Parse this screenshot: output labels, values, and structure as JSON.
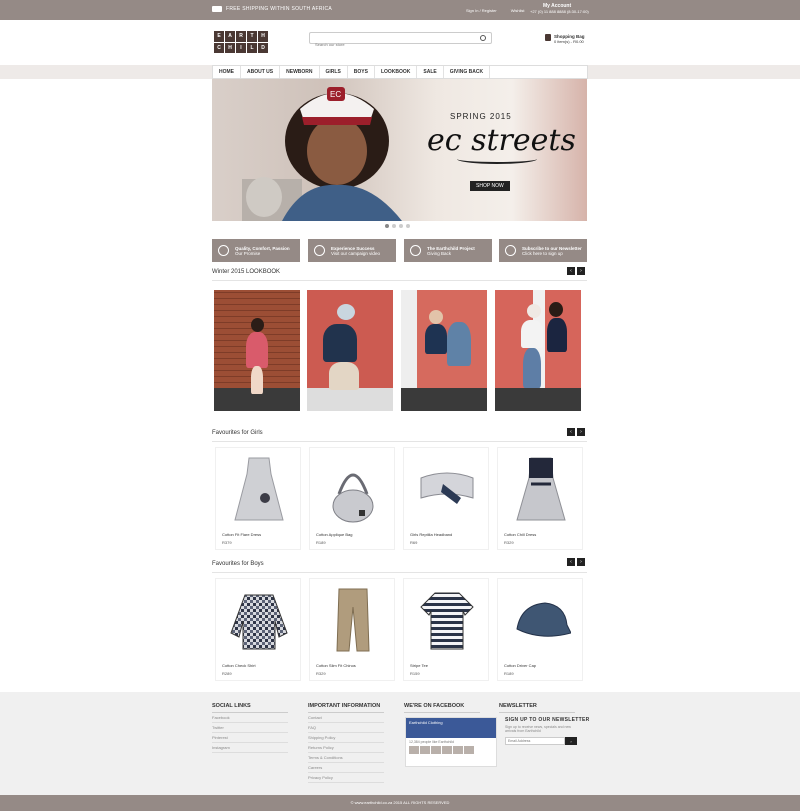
{
  "topbar": {
    "shipping_text": "FREE SHIPPING WITHIN SOUTH AFRICA",
    "link_account": "Sign In / Register",
    "link_wishlist": "Wishlist",
    "account_label": "My Account",
    "phone": "+27 (0) 11 888 8888 (8:30-17:00)"
  },
  "logo": {
    "letters": [
      "E",
      "A",
      "R",
      "T",
      "H",
      "C",
      "H",
      "I",
      "L",
      "D"
    ]
  },
  "search": {
    "placeholder": "Search our store"
  },
  "cart": {
    "title": "Shopping Bag",
    "summary": "0 item(s) - R0.00"
  },
  "nav": {
    "items": [
      "HOME",
      "ABOUT US",
      "NEWBORN",
      "GIRLS",
      "BOYS",
      "LOOKBOOK",
      "SALE",
      "GIVING BACK"
    ]
  },
  "hero": {
    "season": "SPRING 2015",
    "title": "ec streets",
    "cta": "SHOP NOW",
    "cap_text": "EC",
    "slides": 4,
    "active_slide": 1
  },
  "features": [
    {
      "title": "Quality, Comfort, Passion",
      "sub": "Our Promise"
    },
    {
      "title": "Experience Success",
      "sub": "Visit our campaign video"
    },
    {
      "title": "The Earthchild Project",
      "sub": "Giving Back"
    },
    {
      "title": "Subscribe to our Newsletter",
      "sub": "Click here to sign up"
    }
  ],
  "lookbook": {
    "title": "Winter 2015 LOOKBOOK"
  },
  "girls": {
    "title": "Favourites for Girls",
    "products": [
      {
        "name": "Cotton Fit Flare Dress",
        "price": "R379"
      },
      {
        "name": "Cotton Applique Bag",
        "price": "R189"
      },
      {
        "name": "Girls Reptilia Headband",
        "price": "R69"
      },
      {
        "name": "Cotton Chill Dress",
        "price": "R329"
      }
    ]
  },
  "boys": {
    "title": "Favourites for Boys",
    "products": [
      {
        "name": "Cotton Check Shirt",
        "price": "R289"
      },
      {
        "name": "Cotton Slim Fit Chinos",
        "price": "R329"
      },
      {
        "name": "Stripe Tee",
        "price": "R159"
      },
      {
        "name": "Cotton Driver Cap",
        "price": "R189"
      }
    ]
  },
  "footer": {
    "social": {
      "title": "SOCIAL LINKS",
      "items": [
        "Facebook",
        "Twitter",
        "Pinterest",
        "Instagram"
      ]
    },
    "info": {
      "title": "IMPORTANT INFORMATION",
      "items": [
        "Contact",
        "FAQ",
        "Shipping Policy",
        "Returns Policy",
        "Terms & Conditions",
        "Careers",
        "Privacy Policy"
      ]
    },
    "facebook": {
      "title": "WE'RE ON FACEBOOK",
      "page": "Earthchild Clothing",
      "likes": "12,384 people like Earthchild"
    },
    "newsletter": {
      "title": "NEWSLETTER",
      "heading": "SIGN UP TO OUR NEWSLETTER",
      "text": "Sign up to receive news, specials and new arrivals from Earthchild",
      "placeholder": "Email Address",
      "button": "›"
    },
    "copyright": "© www.earthchild.co.za 2015 ALL RIGHTS RESERVED"
  }
}
